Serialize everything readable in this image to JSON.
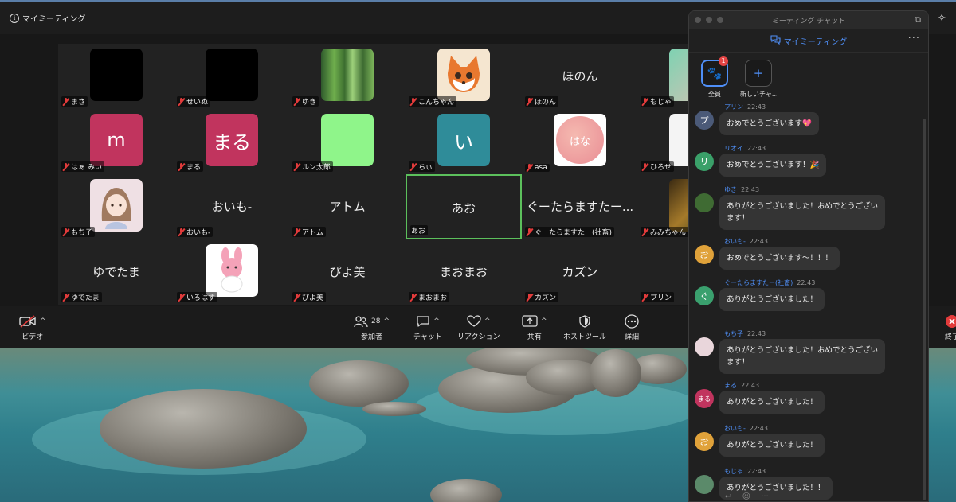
{
  "meeting": {
    "title": "マイミーティング"
  },
  "tiles": [
    {
      "name": "まさ",
      "kind": "avatar-black"
    },
    {
      "name": "せいぬ",
      "kind": "avatar-black"
    },
    {
      "name": "ゆき",
      "kind": "avatar-bamboo"
    },
    {
      "name": "こんちゃん",
      "kind": "avatar-fox"
    },
    {
      "name": "ほのん",
      "kind": "bigname",
      "display": "ほのん"
    },
    {
      "name": "もじゃ",
      "kind": "avatar-partial"
    },
    {
      "name": "はぁ みい",
      "kind": "letter",
      "letter": "m",
      "color": "#c1345e"
    },
    {
      "name": "まる",
      "kind": "letter",
      "letter": "まる",
      "color": "#c1345e"
    },
    {
      "name": "ルン太郎",
      "kind": "avatar-green"
    },
    {
      "name": "ちぃ",
      "kind": "letter",
      "letter": "い",
      "color": "#2f8c99"
    },
    {
      "name": "asa",
      "kind": "avatar-hana",
      "letter": "はな"
    },
    {
      "name": "ひろせ",
      "kind": "avatar-partial-white"
    },
    {
      "name": "もち子",
      "kind": "avatar-girl"
    },
    {
      "name": "おいも-",
      "kind": "bigname",
      "display": "おいも-"
    },
    {
      "name": "アトム",
      "kind": "bigname",
      "display": "アトム"
    },
    {
      "name": "あお",
      "kind": "bigname",
      "display": "あお",
      "active": true
    },
    {
      "name": "ぐーたらますたー(社畜)",
      "kind": "bigname",
      "display": "ぐーたらますたー..."
    },
    {
      "name": "みみちゃん",
      "kind": "avatar-partial-forest"
    },
    {
      "name": "ゆでたま",
      "kind": "bigname",
      "display": "ゆでたま"
    },
    {
      "name": "いろはす",
      "kind": "avatar-bunny"
    },
    {
      "name": "ぴよ美",
      "kind": "bigname",
      "display": "ぴよ美"
    },
    {
      "name": "まおまお",
      "kind": "bigname",
      "display": "まおまお"
    },
    {
      "name": "カズン",
      "kind": "bigname",
      "display": "カズン"
    },
    {
      "name": "プリン",
      "kind": "bigname",
      "display": "プ"
    }
  ],
  "toolbar": {
    "video_label": "ビデオ",
    "participants_label": "参加者",
    "participants_count": "28",
    "chat_label": "チャット",
    "reaction_label": "リアクション",
    "share_label": "共有",
    "host_tools_label": "ホストツール",
    "more_label": "詳細",
    "end_label": "終了"
  },
  "chat": {
    "window_title": "ミーティング チャット",
    "header_title": "マイミーティング",
    "groups": [
      {
        "label": "全員",
        "badge": "1"
      },
      {
        "label": "新しいチャ..."
      }
    ],
    "messages": [
      {
        "sender": "プリン",
        "time": "22:43",
        "text": "おめでとうございます💖",
        "avatar": "プ",
        "avatar_color": "#4b5a78"
      },
      {
        "sender": "リオイ",
        "time": "22:43",
        "text": "おめでとうございます！🎉",
        "avatar": "リ",
        "avatar_color": "#3aa069"
      },
      {
        "sender": "ゆき",
        "time": "22:43",
        "text": "ありがとうございました！おめでとうございます！",
        "avatar": "",
        "avatar_color": "#3f6b33"
      },
      {
        "sender": "おいも-",
        "time": "22:43",
        "text": "おめでとうございます～！！！",
        "avatar": "お",
        "avatar_color": "#e0a23a"
      },
      {
        "sender": "ぐーたらますたー(社畜)",
        "time": "22:43",
        "text": "ありがとうございました！",
        "avatar": "ぐ",
        "avatar_color": "#3aa06e"
      },
      {
        "sender": "もち子",
        "time": "22:43",
        "text": "ありがとうございました！おめでとうございます！",
        "avatar": "",
        "avatar_color": "#e9d6db"
      },
      {
        "sender": "まる",
        "time": "22:43",
        "text": "ありがとうございました！",
        "avatar": "まる",
        "avatar_color": "#c1345e"
      },
      {
        "sender": "おいも-",
        "time": "22:43",
        "text": "ありがとうございました！",
        "avatar": "お",
        "avatar_color": "#e0a23a"
      },
      {
        "sender": "もじゃ",
        "time": "22:43",
        "text": "ありがとうございました！！",
        "avatar": "",
        "avatar_color": "#5b8a6a"
      }
    ]
  }
}
